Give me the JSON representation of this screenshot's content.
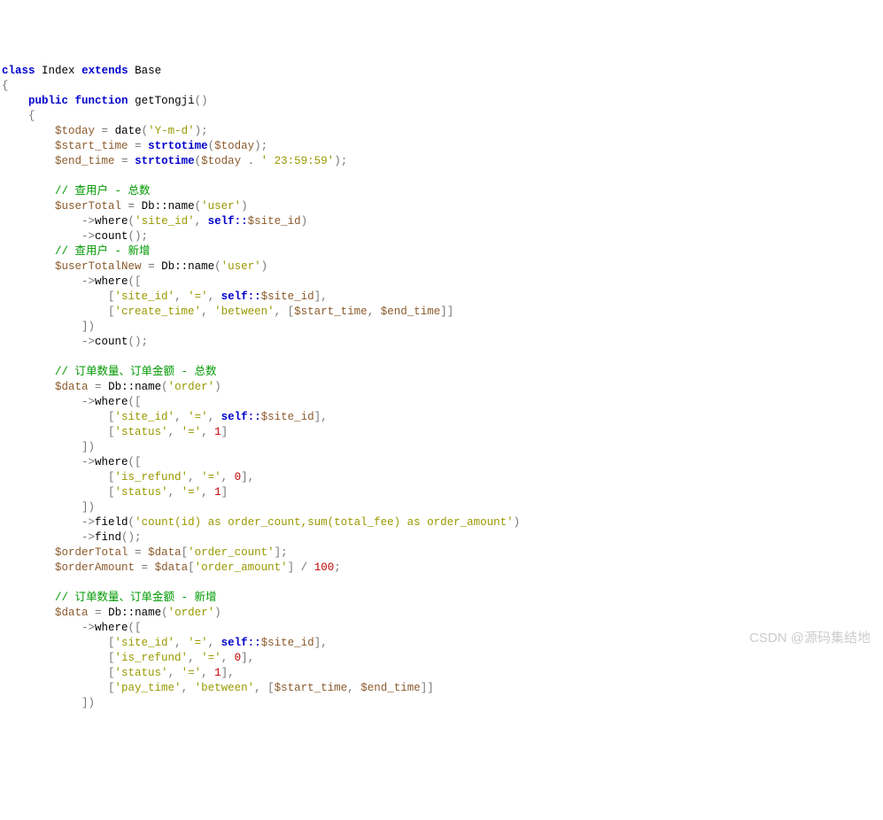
{
  "kw_class": "class",
  "kw_extends": "extends",
  "kw_public": "public",
  "kw_function": "function",
  "kw_self": "self::",
  "cls_index": "Index",
  "cls_base": "Base",
  "fn_main": "getTongji",
  "fn_date": "date",
  "fn_strtotime": "strtotime",
  "fn_where": "where",
  "fn_count": "count",
  "fn_field": "field",
  "fn_find": "find",
  "db_name": "Db::name",
  "v_today": "$today",
  "v_start_time": "$start_time",
  "v_end_time": "$end_time",
  "v_userTotal": "$userTotal",
  "v_userTotalNew": "$userTotalNew",
  "v_data": "$data",
  "v_orderTotal": "$orderTotal",
  "v_orderAmount": "$orderAmount",
  "v_site_id": "$site_id",
  "s_ymd": "'Y-m-d'",
  "s_235959": "' 23:59:59'",
  "s_user": "'user'",
  "s_order": "'order'",
  "s_site_id": "'site_id'",
  "s_create_time": "'create_time'",
  "s_pay_time": "'pay_time'",
  "s_between": "'between'",
  "s_status": "'status'",
  "s_is_refund": "'is_refund'",
  "s_eq": "'='",
  "s_field_expr": "'count(id) as order_count,sum(total_fee) as order_amount'",
  "s_order_count": "'order_count'",
  "s_order_amount": "'order_amount'",
  "n_1": "1",
  "n_0": "0",
  "n_100": "100",
  "cmt_user_total": "// 查用户 - 总数",
  "cmt_user_new": "// 查用户 - 新增",
  "cmt_order_total": "// 订单数量、订单金额 - 总数",
  "cmt_order_new": "// 订单数量、订单金额 - 新增",
  "watermark": "CSDN @源码集结地"
}
